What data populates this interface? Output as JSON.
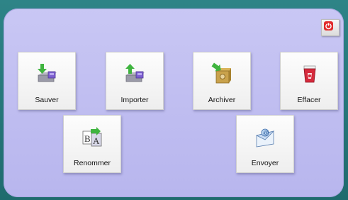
{
  "tiles": {
    "sauver": {
      "label": "Sauver",
      "icon": "save-to-drive-icon"
    },
    "importer": {
      "label": "Importer",
      "icon": "import-from-drive-icon"
    },
    "archiver": {
      "label": "Archiver",
      "icon": "archive-box-icon"
    },
    "effacer": {
      "label": "Effacer",
      "icon": "trash-bin-icon"
    },
    "renommer": {
      "label": "Renommer",
      "icon": "rename-letters-icon"
    },
    "envoyer": {
      "label": "Envoyer",
      "icon": "send-mail-icon"
    }
  },
  "close": {
    "icon": "power-icon"
  },
  "colors": {
    "panel": "#c4c2f2",
    "frame": "#2a7a7d",
    "close_red": "#e12a2a"
  }
}
